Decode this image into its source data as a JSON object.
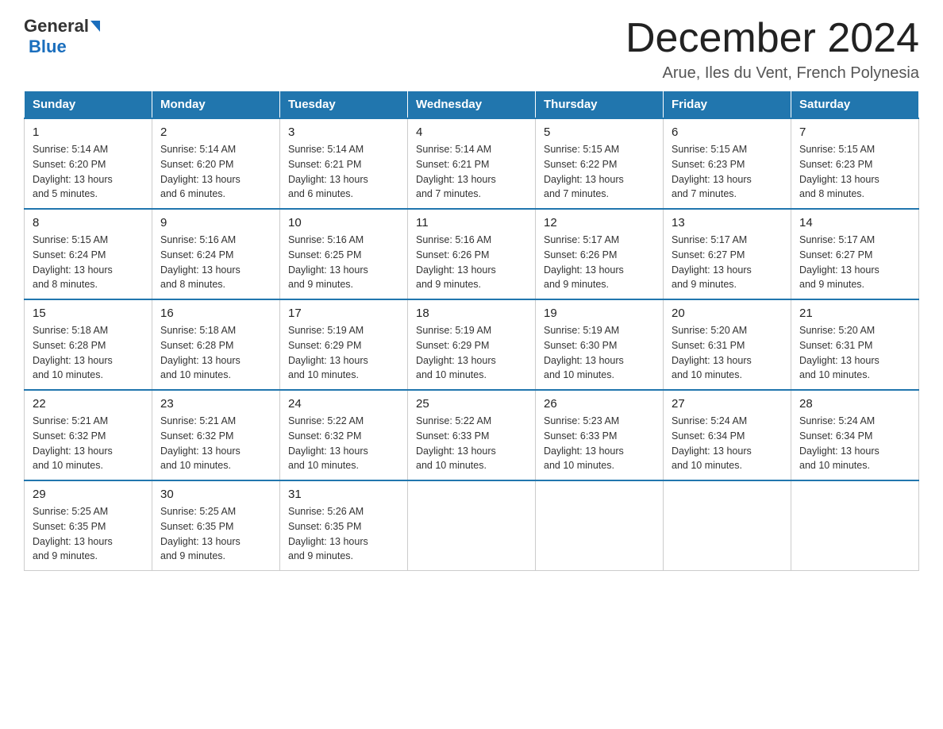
{
  "logo": {
    "general": "General",
    "blue": "Blue"
  },
  "header": {
    "month_title": "December 2024",
    "location": "Arue, Iles du Vent, French Polynesia"
  },
  "weekdays": [
    "Sunday",
    "Monday",
    "Tuesday",
    "Wednesday",
    "Thursday",
    "Friday",
    "Saturday"
  ],
  "weeks": [
    [
      {
        "day": "1",
        "sunrise": "5:14 AM",
        "sunset": "6:20 PM",
        "daylight": "13 hours and 5 minutes."
      },
      {
        "day": "2",
        "sunrise": "5:14 AM",
        "sunset": "6:20 PM",
        "daylight": "13 hours and 6 minutes."
      },
      {
        "day": "3",
        "sunrise": "5:14 AM",
        "sunset": "6:21 PM",
        "daylight": "13 hours and 6 minutes."
      },
      {
        "day": "4",
        "sunrise": "5:14 AM",
        "sunset": "6:21 PM",
        "daylight": "13 hours and 7 minutes."
      },
      {
        "day": "5",
        "sunrise": "5:15 AM",
        "sunset": "6:22 PM",
        "daylight": "13 hours and 7 minutes."
      },
      {
        "day": "6",
        "sunrise": "5:15 AM",
        "sunset": "6:23 PM",
        "daylight": "13 hours and 7 minutes."
      },
      {
        "day": "7",
        "sunrise": "5:15 AM",
        "sunset": "6:23 PM",
        "daylight": "13 hours and 8 minutes."
      }
    ],
    [
      {
        "day": "8",
        "sunrise": "5:15 AM",
        "sunset": "6:24 PM",
        "daylight": "13 hours and 8 minutes."
      },
      {
        "day": "9",
        "sunrise": "5:16 AM",
        "sunset": "6:24 PM",
        "daylight": "13 hours and 8 minutes."
      },
      {
        "day": "10",
        "sunrise": "5:16 AM",
        "sunset": "6:25 PM",
        "daylight": "13 hours and 9 minutes."
      },
      {
        "day": "11",
        "sunrise": "5:16 AM",
        "sunset": "6:26 PM",
        "daylight": "13 hours and 9 minutes."
      },
      {
        "day": "12",
        "sunrise": "5:17 AM",
        "sunset": "6:26 PM",
        "daylight": "13 hours and 9 minutes."
      },
      {
        "day": "13",
        "sunrise": "5:17 AM",
        "sunset": "6:27 PM",
        "daylight": "13 hours and 9 minutes."
      },
      {
        "day": "14",
        "sunrise": "5:17 AM",
        "sunset": "6:27 PM",
        "daylight": "13 hours and 9 minutes."
      }
    ],
    [
      {
        "day": "15",
        "sunrise": "5:18 AM",
        "sunset": "6:28 PM",
        "daylight": "13 hours and 10 minutes."
      },
      {
        "day": "16",
        "sunrise": "5:18 AM",
        "sunset": "6:28 PM",
        "daylight": "13 hours and 10 minutes."
      },
      {
        "day": "17",
        "sunrise": "5:19 AM",
        "sunset": "6:29 PM",
        "daylight": "13 hours and 10 minutes."
      },
      {
        "day": "18",
        "sunrise": "5:19 AM",
        "sunset": "6:29 PM",
        "daylight": "13 hours and 10 minutes."
      },
      {
        "day": "19",
        "sunrise": "5:19 AM",
        "sunset": "6:30 PM",
        "daylight": "13 hours and 10 minutes."
      },
      {
        "day": "20",
        "sunrise": "5:20 AM",
        "sunset": "6:31 PM",
        "daylight": "13 hours and 10 minutes."
      },
      {
        "day": "21",
        "sunrise": "5:20 AM",
        "sunset": "6:31 PM",
        "daylight": "13 hours and 10 minutes."
      }
    ],
    [
      {
        "day": "22",
        "sunrise": "5:21 AM",
        "sunset": "6:32 PM",
        "daylight": "13 hours and 10 minutes."
      },
      {
        "day": "23",
        "sunrise": "5:21 AM",
        "sunset": "6:32 PM",
        "daylight": "13 hours and 10 minutes."
      },
      {
        "day": "24",
        "sunrise": "5:22 AM",
        "sunset": "6:32 PM",
        "daylight": "13 hours and 10 minutes."
      },
      {
        "day": "25",
        "sunrise": "5:22 AM",
        "sunset": "6:33 PM",
        "daylight": "13 hours and 10 minutes."
      },
      {
        "day": "26",
        "sunrise": "5:23 AM",
        "sunset": "6:33 PM",
        "daylight": "13 hours and 10 minutes."
      },
      {
        "day": "27",
        "sunrise": "5:24 AM",
        "sunset": "6:34 PM",
        "daylight": "13 hours and 10 minutes."
      },
      {
        "day": "28",
        "sunrise": "5:24 AM",
        "sunset": "6:34 PM",
        "daylight": "13 hours and 10 minutes."
      }
    ],
    [
      {
        "day": "29",
        "sunrise": "5:25 AM",
        "sunset": "6:35 PM",
        "daylight": "13 hours and 9 minutes."
      },
      {
        "day": "30",
        "sunrise": "5:25 AM",
        "sunset": "6:35 PM",
        "daylight": "13 hours and 9 minutes."
      },
      {
        "day": "31",
        "sunrise": "5:26 AM",
        "sunset": "6:35 PM",
        "daylight": "13 hours and 9 minutes."
      },
      null,
      null,
      null,
      null
    ]
  ],
  "labels": {
    "sunrise": "Sunrise:",
    "sunset": "Sunset:",
    "daylight": "Daylight:"
  }
}
